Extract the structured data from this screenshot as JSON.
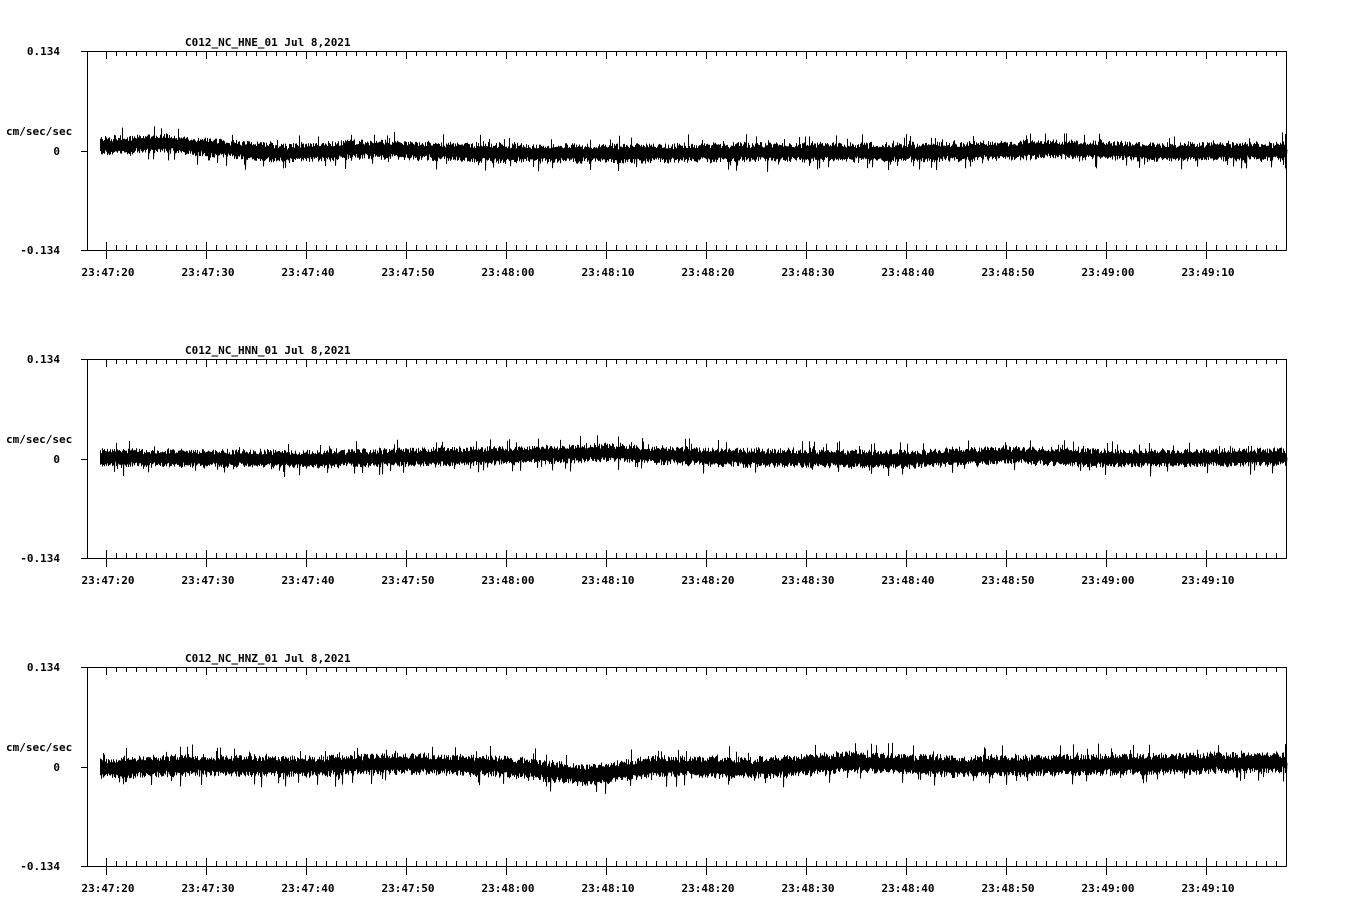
{
  "chart_data": [
    {
      "type": "line",
      "title": "C012_NC_HNE_01   Jul 8,2021",
      "ylabel": "cm/sec/sec",
      "ylim": [
        -0.134,
        0.134
      ],
      "y_ticks": [
        "0.134",
        "0",
        "-0.134"
      ],
      "x_tick_labels": [
        "23:47:20",
        "23:47:30",
        "23:47:40",
        "23:47:50",
        "23:48:00",
        "23:48:10",
        "23:48:20",
        "23:48:30",
        "23:48:40",
        "23:48:50",
        "23:49:00",
        "23:49:10"
      ],
      "x_start": "23:47:19.3",
      "x_end": "23:49:18",
      "trend": [
        {
          "t": "23:47:20",
          "y": 0.006
        },
        {
          "t": "23:47:26",
          "y": 0.01
        },
        {
          "t": "23:47:30",
          "y": 0.004
        },
        {
          "t": "23:47:38",
          "y": -0.004
        },
        {
          "t": "23:47:46",
          "y": 0.002
        },
        {
          "t": "23:47:55",
          "y": -0.002
        },
        {
          "t": "23:48:05",
          "y": -0.004
        },
        {
          "t": "23:48:15",
          "y": -0.004
        },
        {
          "t": "23:48:25",
          "y": -0.002
        },
        {
          "t": "23:48:35",
          "y": -0.003
        },
        {
          "t": "23:48:45",
          "y": -0.002
        },
        {
          "t": "23:48:55",
          "y": 0.002
        },
        {
          "t": "23:49:05",
          "y": -0.002
        },
        {
          "t": "23:49:18",
          "y": -0.001
        }
      ],
      "noise_amplitude": 0.018
    },
    {
      "type": "line",
      "title": "C012_NC_HNN_01   Jul 8,2021",
      "ylabel": "cm/sec/sec",
      "ylim": [
        -0.134,
        0.134
      ],
      "y_ticks": [
        "0.134",
        "0",
        "-0.134"
      ],
      "x_tick_labels": [
        "23:47:20",
        "23:47:30",
        "23:47:40",
        "23:47:50",
        "23:48:00",
        "23:48:10",
        "23:48:20",
        "23:48:30",
        "23:48:40",
        "23:48:50",
        "23:49:00",
        "23:49:10"
      ],
      "x_start": "23:47:19.3",
      "x_end": "23:49:18",
      "trend": [
        {
          "t": "23:47:20",
          "y": 0.001
        },
        {
          "t": "23:47:30",
          "y": 0.0
        },
        {
          "t": "23:47:40",
          "y": -0.001
        },
        {
          "t": "23:47:50",
          "y": 0.002
        },
        {
          "t": "23:48:00",
          "y": 0.004
        },
        {
          "t": "23:48:10",
          "y": 0.008
        },
        {
          "t": "23:48:20",
          "y": 0.002
        },
        {
          "t": "23:48:30",
          "y": 0.0
        },
        {
          "t": "23:48:40",
          "y": -0.001
        },
        {
          "t": "23:48:50",
          "y": 0.005
        },
        {
          "t": "23:49:00",
          "y": 0.0
        },
        {
          "t": "23:49:18",
          "y": 0.002
        }
      ],
      "noise_amplitude": 0.017
    },
    {
      "type": "line",
      "title": "C012_NC_HNZ_01   Jul 8,2021",
      "ylabel": "cm/sec/sec",
      "ylim": [
        -0.134,
        0.134
      ],
      "y_ticks": [
        "0.134",
        "0",
        "-0.134"
      ],
      "x_tick_labels": [
        "23:47:20",
        "23:47:30",
        "23:47:40",
        "23:47:50",
        "23:48:00",
        "23:48:10",
        "23:48:20",
        "23:48:30",
        "23:48:40",
        "23:48:50",
        "23:49:00",
        "23:49:10"
      ],
      "x_start": "23:47:19.3",
      "x_end": "23:49:18",
      "trend": [
        {
          "t": "23:47:20",
          "y": -0.002
        },
        {
          "t": "23:47:30",
          "y": 0.002
        },
        {
          "t": "23:47:40",
          "y": 0.0
        },
        {
          "t": "23:47:50",
          "y": 0.004
        },
        {
          "t": "23:48:00",
          "y": 0.0
        },
        {
          "t": "23:48:08",
          "y": -0.012
        },
        {
          "t": "23:48:15",
          "y": 0.0
        },
        {
          "t": "23:48:25",
          "y": -0.002
        },
        {
          "t": "23:48:35",
          "y": 0.006
        },
        {
          "t": "23:48:45",
          "y": 0.0
        },
        {
          "t": "23:48:55",
          "y": 0.002
        },
        {
          "t": "23:49:05",
          "y": 0.003
        },
        {
          "t": "23:49:18",
          "y": 0.006
        }
      ],
      "noise_amplitude": 0.02
    }
  ]
}
